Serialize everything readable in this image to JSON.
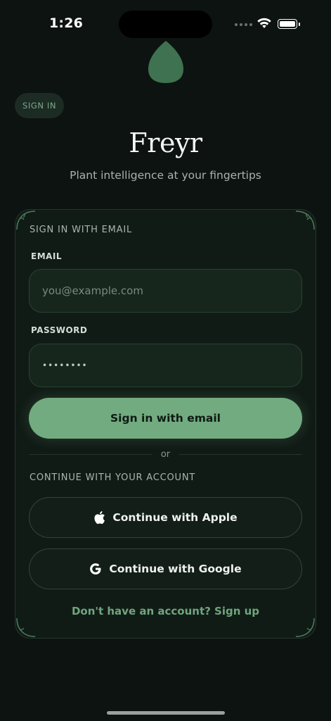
{
  "status_bar": {
    "time": "1:26"
  },
  "header": {
    "chip_label": "SIGN IN",
    "brand": "Freyr",
    "tagline": "Plant intelligence at your fingertips"
  },
  "email_section": {
    "title": "SIGN IN WITH EMAIL",
    "email_label": "EMAIL",
    "email_placeholder": "you@example.com",
    "password_label": "PASSWORD",
    "password_value": "••••••••",
    "submit_label": "Sign in with email"
  },
  "divider": {
    "text": "or"
  },
  "account_section": {
    "title": "CONTINUE WITH YOUR ACCOUNT",
    "apple_label": "Continue with Apple",
    "apple_icon": "apple-icon",
    "google_label": "Continue with Google",
    "google_icon": "google-icon"
  },
  "footer": {
    "signup_text": "Don't have an account? Sign up"
  },
  "colors": {
    "background": "#0d1310",
    "card": "#111b16",
    "accent": "#72ab80",
    "accent_text": "#6fa57d"
  }
}
